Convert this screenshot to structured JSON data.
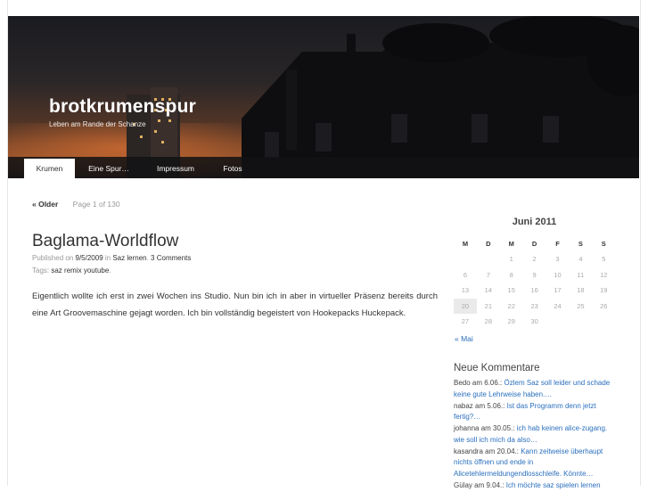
{
  "site": {
    "title": "brotkrumenspur",
    "description": "Leben am Rande der Schanze"
  },
  "nav": {
    "items": [
      {
        "label": "Krumen",
        "active": true
      },
      {
        "label": "Eine Spur…",
        "active": false
      },
      {
        "label": "Impressum",
        "active": false
      },
      {
        "label": "Fotos",
        "active": false
      }
    ]
  },
  "pager": {
    "older": "« Older",
    "page": "Page 1 of 130"
  },
  "post": {
    "title": "Baglama-Worldflow",
    "published_prefix": "Published on",
    "date": "9/5/2009",
    "in_word": "in",
    "category": "Saz lernen",
    "comments": "3 Comments",
    "tags_label": "Tags:",
    "tags": [
      "saz",
      "remix",
      "youtube"
    ],
    "body": "Eigentlich wollte ich erst in zwei Wochen ins Studio. Nun bin ich in aber in virtueller Präsenz bereits durch eine Art Groovemaschine gejagt worden. Ich bin vollständig begeistert von Hookepacks Huckepack."
  },
  "calendar": {
    "caption": "Juni 2011",
    "days": [
      "M",
      "D",
      "M",
      "D",
      "F",
      "S",
      "S"
    ],
    "weeks": [
      [
        "",
        "",
        "1",
        "2",
        "3",
        "4",
        "5"
      ],
      [
        "6",
        "7",
        "8",
        "9",
        "10",
        "11",
        "12"
      ],
      [
        "13",
        "14",
        "15",
        "16",
        "17",
        "18",
        "19"
      ],
      [
        "20",
        "21",
        "22",
        "23",
        "24",
        "25",
        "26"
      ],
      [
        "27",
        "28",
        "29",
        "30",
        "",
        "",
        ""
      ]
    ],
    "today": "20",
    "prev_link": "« Mai"
  },
  "recent_comments": {
    "title": "Neue Kommentare",
    "items": [
      {
        "author": "Bedo",
        "date_text": "am 6.06.:",
        "link": "Özlem Saz soll leider und schade keine gute Lehrweise haben.…"
      },
      {
        "author": "nabaz",
        "date_text": "am 5.06.:",
        "link": "Ist das Programm denn jetzt fertig?…"
      },
      {
        "author": "johanna",
        "date_text": "am 30.05.:",
        "link": "ich hab keinen alice-zugang. wie soll ich mich da also…"
      },
      {
        "author": "kasandra",
        "date_text": "am 20.04.:",
        "link": "Kann zeitweise überhaupt nichts öffnen und ende in Alicetehlermeldungendlosschleife. Könnte…"
      },
      {
        "author": "Gülay",
        "date_text": "am 9.04.:",
        "link": "Ich möchte saz spielen lernen"
      }
    ]
  },
  "colors": {
    "link": "#2a6fbd",
    "header_sky_dark": "#1a1b20",
    "header_sunset": "#8a4e2a"
  }
}
